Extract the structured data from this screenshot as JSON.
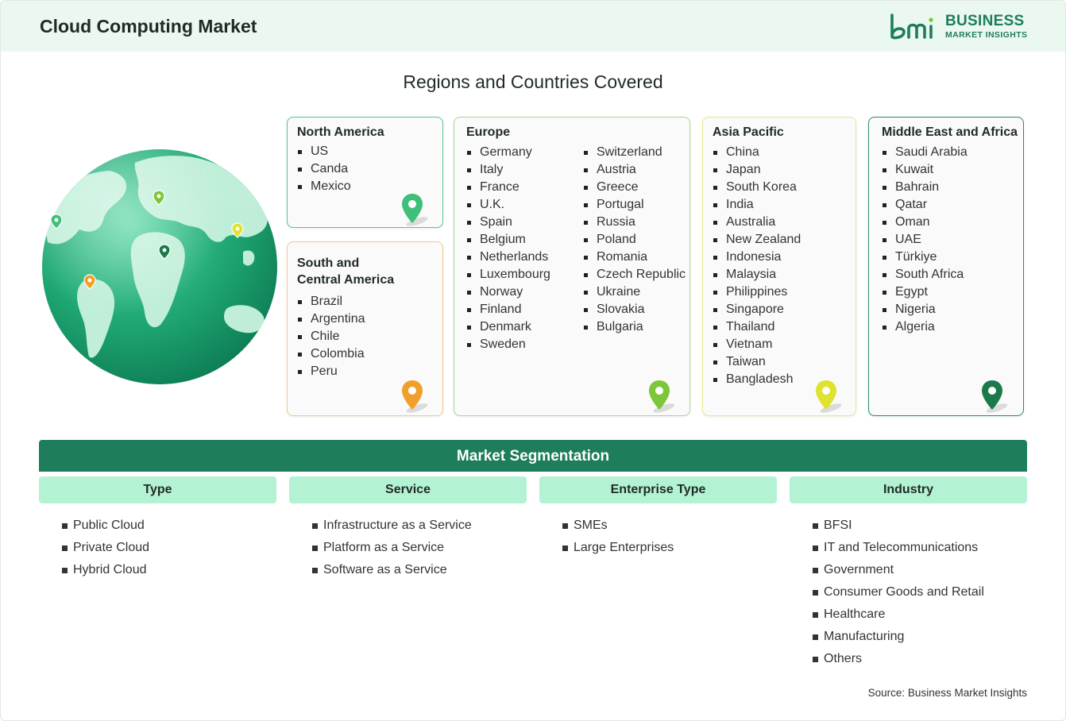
{
  "header": {
    "title": "Cloud Computing Market",
    "logo": {
      "mark": "bmi",
      "line1": "BUSINESS",
      "line2": "MARKET INSIGHTS",
      "color": "#1e7d5a"
    }
  },
  "regions": {
    "title": "Regions and Countries Covered",
    "cards": [
      {
        "name": "North America",
        "color": "#58c48a",
        "pin_color": "#3fbf7a",
        "countries": [
          "US",
          "Canda",
          "Mexico"
        ]
      },
      {
        "name": "South and Central America",
        "title_lines": [
          "South and",
          "Central America"
        ],
        "color": "#f3c98a",
        "pin_color": "#f0a02a",
        "countries": [
          "Brazil",
          "Argentina",
          "Chile",
          "Colombia",
          "Peru"
        ]
      },
      {
        "name": "Europe",
        "color": "#a8dc8c",
        "pin_color": "#7cc63a",
        "countries_col1": [
          "Germany",
          "Italy",
          "France",
          "U.K.",
          "Spain",
          "Belgium",
          "Netherlands",
          "Luxembourg",
          "Norway",
          "Finland",
          "Denmark",
          "Sweden"
        ],
        "countries_col2": [
          "Switzerland",
          "Austria",
          "Greece",
          "Portugal",
          "Russia",
          "Poland",
          "Romania",
          "Czech Republic",
          "Ukraine",
          "Slovakia",
          "Bulgaria"
        ]
      },
      {
        "name": "Asia Pacific",
        "color": "#e6ea8a",
        "pin_color": "#dfe22e",
        "countries": [
          "China",
          "Japan",
          "South Korea",
          "India",
          "Australia",
          "New Zealand",
          "Indonesia",
          "Malaysia",
          "Philippines",
          "Singapore",
          "Thailand",
          "Vietnam",
          "Taiwan",
          "Bangladesh"
        ]
      },
      {
        "name": "Middle East and Africa",
        "color": "#2e8c62",
        "pin_color": "#1a7a4a",
        "countries": [
          "Saudi Arabia",
          "Kuwait",
          "Bahrain",
          "Qatar",
          "Oman",
          "UAE",
          "Türkiye",
          "South Africa",
          "Egypt",
          "Nigeria",
          "Algeria"
        ]
      }
    ]
  },
  "segmentation": {
    "title": "Market Segmentation",
    "columns": [
      {
        "label": "Type",
        "items": [
          "Public Cloud",
          "Private Cloud",
          "Hybrid Cloud"
        ]
      },
      {
        "label": "Service",
        "items": [
          "Infrastructure as a Service",
          "Platform as a Service",
          "Software as a Service"
        ]
      },
      {
        "label": "Enterprise Type",
        "items": [
          "SMEs",
          "Large Enterprises"
        ]
      },
      {
        "label": "Industry",
        "items": [
          "BFSI",
          "IT and Telecommunications",
          "Government",
          "Consumer Goods and Retail",
          "Healthcare",
          "Manufacturing",
          "Others"
        ]
      }
    ]
  },
  "source": "Source: Business Market Insights"
}
